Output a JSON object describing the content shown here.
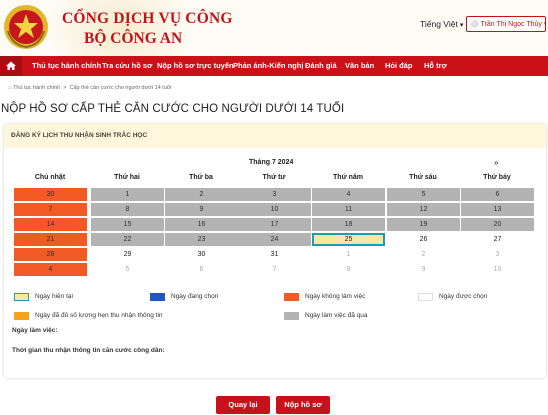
{
  "header": {
    "title_line1": "CỔNG DỊCH VỤ CÔNG",
    "title_line2": "BỘ CÔNG AN",
    "language": "Tiếng Việt",
    "user_name": "Trần Thị Ngọc Thủy"
  },
  "nav": {
    "items": [
      "Thủ tục hành chính",
      "Tra cứu hồ sơ",
      "Nộp hồ sơ trực tuyến",
      "Phản ánh-Kiến nghị",
      "Đánh giá",
      "Văn bản",
      "Hỏi đáp",
      "Hỗ trợ"
    ]
  },
  "breadcrumb": {
    "items": [
      "Thủ tục hành chính",
      "Cấp thẻ căn cước cho người dưới 14 tuổi"
    ]
  },
  "page_title": "NỘP HỒ SƠ CẤP THẺ CĂN CƯỚC CHO NGƯỜI DƯỚI 14 TUỔI",
  "card": {
    "heading": "ĐĂNG KÝ LỊCH THU NHẬN SINH TRẮC HỌC"
  },
  "calendar": {
    "month_label": "Tháng 7 2024",
    "next_label": "»",
    "weekdays": [
      "Chủ nhật",
      "Thứ hai",
      "Thứ ba",
      "Thứ tư",
      "Thứ năm",
      "Thứ sáu",
      "Thứ bảy"
    ],
    "weeks": [
      [
        {
          "d": "30",
          "s": "off"
        },
        {
          "d": "1",
          "s": "past"
        },
        {
          "d": "2",
          "s": "past"
        },
        {
          "d": "3",
          "s": "past"
        },
        {
          "d": "4",
          "s": "past"
        },
        {
          "d": "5",
          "s": "past"
        },
        {
          "d": "6",
          "s": "past"
        }
      ],
      [
        {
          "d": "7",
          "s": "off"
        },
        {
          "d": "8",
          "s": "past"
        },
        {
          "d": "9",
          "s": "past"
        },
        {
          "d": "10",
          "s": "past"
        },
        {
          "d": "11",
          "s": "past"
        },
        {
          "d": "12",
          "s": "past"
        },
        {
          "d": "13",
          "s": "past"
        }
      ],
      [
        {
          "d": "14",
          "s": "off"
        },
        {
          "d": "15",
          "s": "past"
        },
        {
          "d": "16",
          "s": "past"
        },
        {
          "d": "17",
          "s": "past"
        },
        {
          "d": "18",
          "s": "past"
        },
        {
          "d": "19",
          "s": "past"
        },
        {
          "d": "20",
          "s": "past"
        }
      ],
      [
        {
          "d": "21",
          "s": "off"
        },
        {
          "d": "22",
          "s": "past"
        },
        {
          "d": "23",
          "s": "past"
        },
        {
          "d": "24",
          "s": "past"
        },
        {
          "d": "25",
          "s": "today"
        },
        {
          "d": "26",
          "s": "free"
        },
        {
          "d": "27",
          "s": "free"
        }
      ],
      [
        {
          "d": "28",
          "s": "off"
        },
        {
          "d": "29",
          "s": "free"
        },
        {
          "d": "30",
          "s": "free"
        },
        {
          "d": "31",
          "s": "free"
        },
        {
          "d": "1",
          "s": "dim"
        },
        {
          "d": "2",
          "s": "dim"
        },
        {
          "d": "3",
          "s": "dim"
        }
      ],
      [
        {
          "d": "4",
          "s": "off"
        },
        {
          "d": "5",
          "s": "dim"
        },
        {
          "d": "6",
          "s": "dim"
        },
        {
          "d": "7",
          "s": "dim"
        },
        {
          "d": "8",
          "s": "dim"
        },
        {
          "d": "9",
          "s": "dim"
        },
        {
          "d": "10",
          "s": "dim"
        }
      ]
    ]
  },
  "legend": [
    {
      "label": "Ngày hiện tại",
      "color": "#fbe7a5",
      "border": "#1e9bb1"
    },
    {
      "label": "Ngày đang chọn",
      "color": "#1f55c4",
      "border": "#1f55c4"
    },
    {
      "label": "Ngày không làm việc",
      "color": "#f15a24",
      "border": "#f15a24"
    },
    {
      "label": "Ngày được chọn",
      "color": "#ffffff",
      "border": "#dddddd"
    },
    {
      "label": "Ngày đã đủ số lượng hẹn thu nhận thông tin",
      "color": "#f7a21b",
      "border": "#f7a21b"
    },
    {
      "label": "Ngày làm việc đã qua",
      "color": "#b3b3b3",
      "border": "#b3b3b3"
    }
  ],
  "fields": {
    "working_day": "Ngày làm việc:",
    "time_label": "Thời gian thu nhận thông tin căn cước công dân:"
  },
  "buttons": {
    "back": "Quay lại",
    "submit": "Nộp hồ sơ"
  }
}
